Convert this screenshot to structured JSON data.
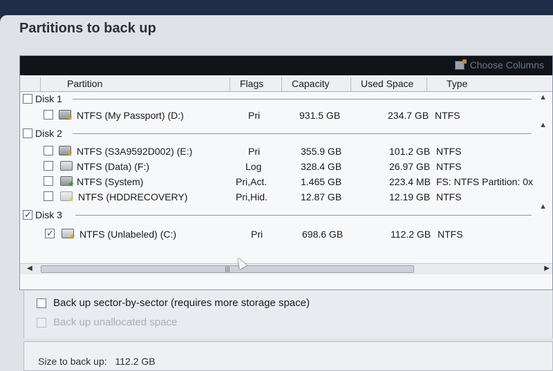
{
  "window": {
    "title": "Partitions to back up"
  },
  "toolbar": {
    "choose_columns_label": "Choose Columns",
    "choose_columns_icon": "columns-icon"
  },
  "columns": [
    "Partition",
    "Flags",
    "Capacity",
    "Used Space",
    "Type"
  ],
  "disks": [
    {
      "label": "Disk 1",
      "checked": false,
      "partitions": [
        {
          "name": "NTFS (My Passport) (D:)",
          "flags": "Pri",
          "capacity": "931.5 GB",
          "used": "234.7 GB",
          "type": "NTFS",
          "checked": false,
          "icon": "drive-star-icon"
        }
      ]
    },
    {
      "label": "Disk 2",
      "checked": false,
      "partitions": [
        {
          "name": "NTFS (S3A9592D002) (E:)",
          "flags": "Pri",
          "capacity": "355.9 GB",
          "used": "101.2 GB",
          "type": "NTFS",
          "checked": false,
          "icon": "drive-star-icon"
        },
        {
          "name": "NTFS (Data) (F:)",
          "flags": "Log",
          "capacity": "328.4 GB",
          "used": "26.97 GB",
          "type": "NTFS",
          "checked": false,
          "icon": "drive-icon"
        },
        {
          "name": "NTFS (System)",
          "flags": "Pri,Act.",
          "capacity": "1.465 GB",
          "used": "223.4 MB",
          "type": "FS: NTFS Partition: 0x",
          "checked": false,
          "icon": "drive-system-icon"
        },
        {
          "name": "NTFS (HDDRECOVERY)",
          "flags": "Pri,Hid.",
          "capacity": "12.87 GB",
          "used": "12.19 GB",
          "type": "NTFS",
          "checked": false,
          "icon": "drive-hidden-icon"
        }
      ]
    },
    {
      "label": "Disk 3",
      "checked": true,
      "partitions": [
        {
          "name": "NTFS (Unlabeled) (C:)",
          "flags": "Pri",
          "capacity": "698.6 GB",
          "used": "112.2 GB",
          "type": "NTFS",
          "checked": true,
          "icon": "drive-star-icon"
        }
      ]
    }
  ],
  "options": {
    "sector_by_sector": {
      "label": "Back up sector-by-sector (requires more storage space)",
      "checked": false,
      "enabled": true
    },
    "unallocated": {
      "label": "Back up unallocated space",
      "checked": false,
      "enabled": false
    }
  },
  "summary": {
    "size_label": "Size to back up:",
    "size_value": "112.2 GB"
  }
}
